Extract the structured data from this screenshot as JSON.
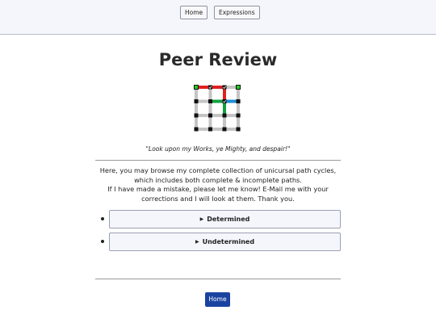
{
  "nav": {
    "home_label": "Home",
    "expressions_label": "Expressions"
  },
  "page": {
    "title": "Peer Review",
    "quote": "\"Look upon my Works, ye Mighty, and despair!\"",
    "intro_line1": "Here, you may browse my complete collection of unicursal path cycles, which includes both complete & incomplete paths.",
    "intro_line2": "If I have made a mistake, please let me know! E-Mail me with your corrections and I will look at them. Thank you."
  },
  "sections": [
    {
      "label": "Determined",
      "expanded": false
    },
    {
      "label": "Undetermined",
      "expanded": false
    }
  ],
  "footer": {
    "home_label": "Home"
  },
  "colors": {
    "accent": "#1a43a0",
    "path_red": "#e02020",
    "path_green": "#0fa040",
    "path_blue": "#1b8fd6",
    "grid_gray": "#c4c4c4",
    "start_node": "#22cc22"
  }
}
